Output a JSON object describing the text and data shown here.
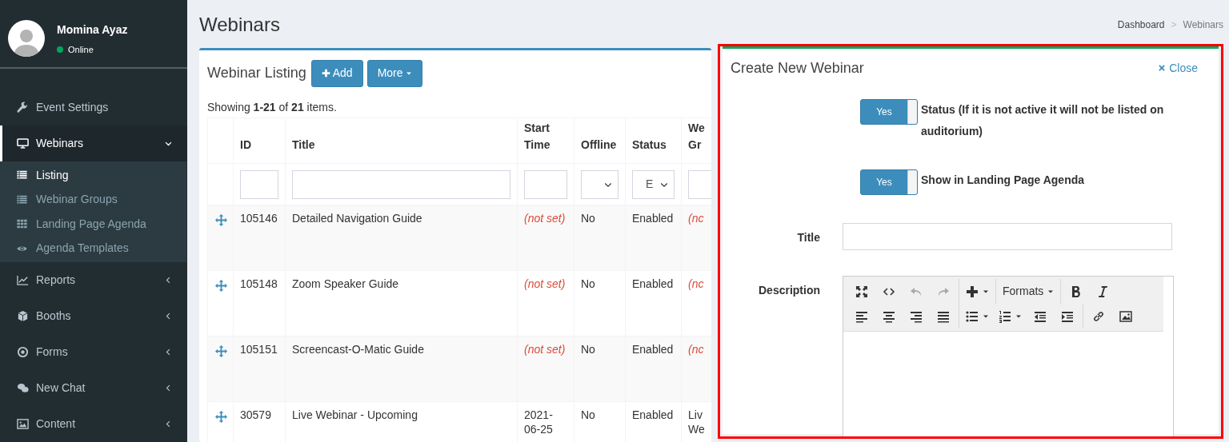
{
  "sidebar": {
    "user": {
      "name": "Momina Ayaz",
      "status": "Online",
      "online": true
    },
    "items": [
      {
        "label": "Event Settings",
        "kind": "link",
        "selected": false
      },
      {
        "label": "Webinars",
        "kind": "menu",
        "selected": true,
        "expanded": true,
        "children": [
          {
            "label": "Listing",
            "selected": true
          },
          {
            "label": "Webinar Groups",
            "selected": false
          },
          {
            "label": "Landing Page Agenda",
            "selected": false
          },
          {
            "label": "Agenda Templates",
            "selected": false
          }
        ]
      },
      {
        "label": "Reports",
        "kind": "menu",
        "selected": false,
        "expanded": false
      },
      {
        "label": "Booths",
        "kind": "menu",
        "selected": false,
        "expanded": false
      },
      {
        "label": "Forms",
        "kind": "menu",
        "selected": false,
        "expanded": false
      },
      {
        "label": "New Chat",
        "kind": "menu",
        "selected": false,
        "expanded": false
      },
      {
        "label": "Content",
        "kind": "menu",
        "selected": false,
        "expanded": false
      }
    ]
  },
  "page": {
    "title": "Webinars",
    "breadcrumb": [
      "Dashboard",
      ">",
      "Webinars"
    ]
  },
  "listing": {
    "title": "Webinar Listing",
    "buttons": [
      {
        "label": "Add",
        "kind": "add"
      },
      {
        "label": "More",
        "kind": "dropdown"
      }
    ],
    "summary": "Showing **1-21** of **21** items.",
    "columns": [
      "",
      "ID",
      "Title",
      "Start Time",
      "Offline",
      "Status",
      "We Gr"
    ],
    "filters": [
      {
        "kind": "none"
      },
      {
        "kind": "text"
      },
      {
        "kind": "text"
      },
      {
        "kind": "text"
      },
      {
        "kind": "select"
      },
      {
        "kind": "select",
        "value": "E"
      },
      {
        "kind": "text"
      }
    ],
    "rows": [
      {
        "id": "105146",
        "title": "Detailed Navigation Guide",
        "start_time": "(not set)",
        "start_time_set": false,
        "offline": "No",
        "status": "Enabled",
        "column_7": "(nc",
        "column_7_set": false
      },
      {
        "id": "105148",
        "title": "Zoom Speaker Guide",
        "start_time": "(not set)",
        "start_time_set": false,
        "offline": "No",
        "status": "Enabled",
        "column_7": "(nc",
        "column_7_set": false
      },
      {
        "id": "105151",
        "title": "Screencast-O-Matic Guide",
        "start_time": "(not set)",
        "start_time_set": false,
        "offline": "No",
        "status": "Enabled",
        "column_7": "(nc",
        "column_7_set": false
      },
      {
        "id": "30579",
        "title": "Live Webinar - Upcoming",
        "start_time": "2021- 06-25",
        "start_time_set": true,
        "offline": "No",
        "status": "Enabled",
        "column_7": "Liv We",
        "column_7_set": true
      }
    ]
  },
  "form": {
    "title": "Create New Webinar",
    "close": "Close",
    "toggles": [
      {
        "on": true,
        "label_on": "Yes",
        "label": "Status (If it is not active it will not be listed on auditorium)"
      },
      {
        "on": true,
        "label_on": "Yes",
        "label": "Show in Landing Page Agenda"
      }
    ],
    "title_field": {
      "label": "Title"
    },
    "description": {
      "label": "Description",
      "toolbar": [
        [
          {
            "kind": "fullscreen",
            "disabled": false
          },
          {
            "kind": "code",
            "disabled": false
          },
          {
            "kind": "undo",
            "disabled": true
          },
          {
            "kind": "redo",
            "disabled": true
          }
        ],
        [
          {
            "kind": "insert",
            "disabled": false
          }
        ],
        [
          {
            "kind": "formats",
            "label": "Formats",
            "disabled": false
          }
        ],
        [
          {
            "kind": "bold",
            "disabled": false
          },
          {
            "kind": "italic",
            "disabled": false
          }
        ],
        [
          {
            "kind": "align-left",
            "disabled": false
          },
          {
            "kind": "align-center",
            "disabled": false
          },
          {
            "kind": "align-right",
            "disabled": false
          },
          {
            "kind": "justify",
            "disabled": false
          }
        ],
        [
          {
            "kind": "bullet-list",
            "disabled": false
          },
          {
            "kind": "number-list",
            "disabled": false
          },
          {
            "kind": "outdent",
            "disabled": false
          },
          {
            "kind": "indent",
            "disabled": false
          }
        ],
        [
          {
            "kind": "link",
            "disabled": false
          },
          {
            "kind": "image",
            "disabled": false
          }
        ]
      ]
    }
  }
}
